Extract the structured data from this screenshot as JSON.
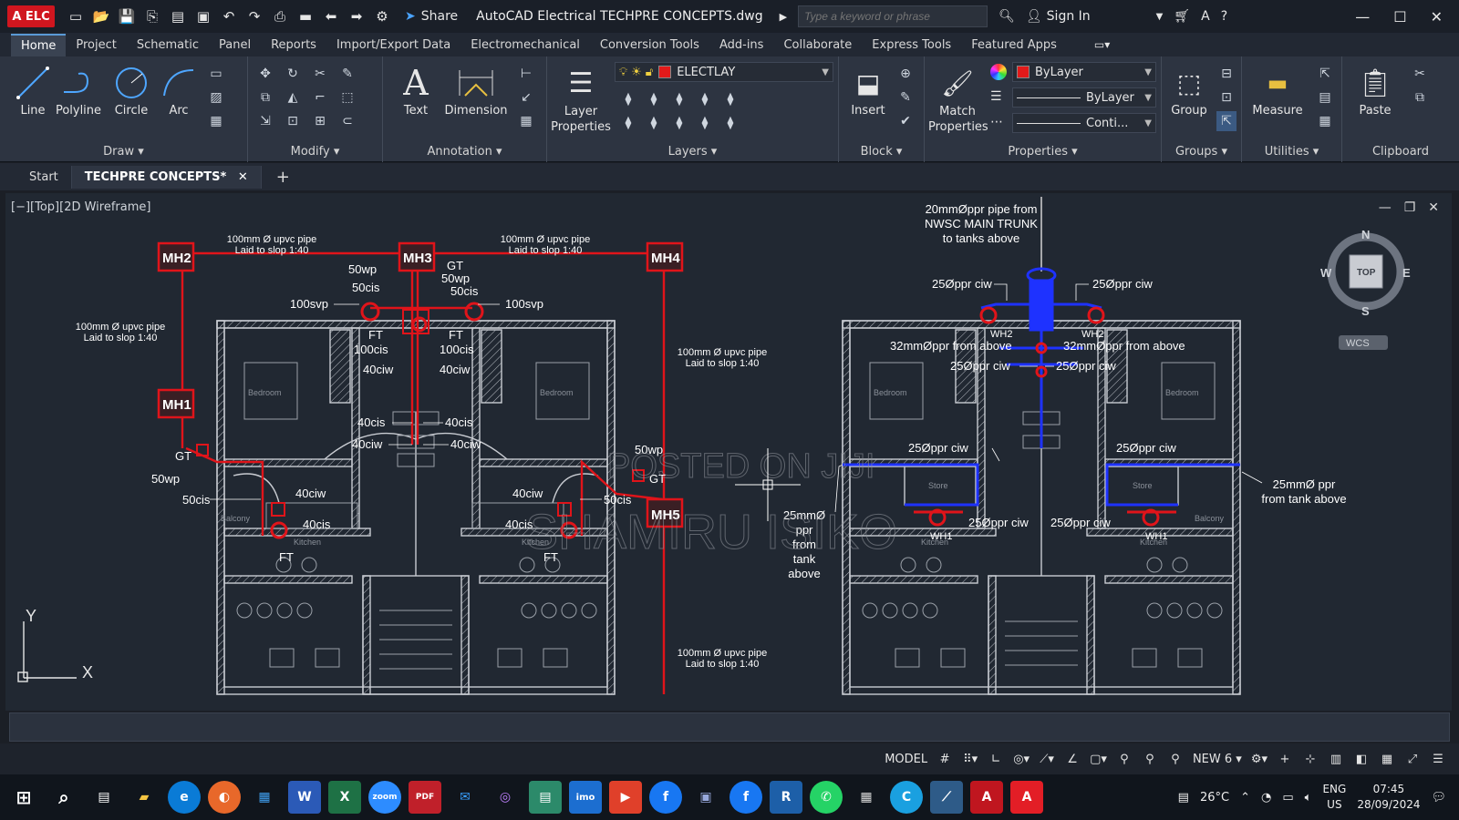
{
  "titlebar": {
    "logo": "A ELC",
    "share": "Share",
    "title": "AutoCAD Electrical   TECHPRE CONCEPTS.dwg",
    "search_placeholder": "Type a keyword or phrase",
    "sign_in": "Sign In"
  },
  "ribbon_tabs": [
    "Home",
    "Project",
    "Schematic",
    "Panel",
    "Reports",
    "Import/Export Data",
    "Electromechanical",
    "Conversion Tools",
    "Add-ins",
    "Collaborate",
    "Express Tools",
    "Featured Apps"
  ],
  "ribbon": {
    "draw": {
      "line": "Line",
      "polyline": "Polyline",
      "circle": "Circle",
      "arc": "Arc",
      "title": "Draw"
    },
    "modify_title": "Modify",
    "annotation": {
      "text": "Text",
      "dimension": "Dimension",
      "title": "Annotation"
    },
    "layers": {
      "layer_properties": "Layer Properties",
      "current_layer": "ELECTLAY",
      "title": "Layers"
    },
    "block": {
      "insert": "Insert",
      "title": "Block"
    },
    "properties": {
      "match": "Match Properties",
      "color": "ByLayer",
      "lineweight": "ByLayer",
      "linetype": "Conti...",
      "title": "Properties"
    },
    "groups": {
      "group": "Group",
      "title": "Groups"
    },
    "utilities": {
      "measure": "Measure",
      "title": "Utilities"
    },
    "clipboard": {
      "paste": "Paste",
      "title": "Clipboard"
    }
  },
  "doc_tabs": {
    "start": "Start",
    "active": "TECHPRE CONCEPTS*"
  },
  "viewport": {
    "label": "[−][Top][2D Wireframe]"
  },
  "viewcube": {
    "n": "N",
    "s": "S",
    "e": "E",
    "w": "W",
    "top": "TOP",
    "wcs": "WCS"
  },
  "ucs": {
    "x": "X",
    "y": "Y"
  },
  "drawing": {
    "manholes": [
      "MH1",
      "MH2",
      "MH3",
      "MH4",
      "MH5"
    ],
    "pipe_label_main": "100mm Ø upvc pipe",
    "slope_label": "Laid to slop 1:40",
    "left_labels": [
      "GT",
      "50wp",
      "50cis",
      "100svp",
      "FT",
      "100cis",
      "40ciw",
      "40cis",
      "40ciw",
      "50wp",
      "50cis",
      "40ciw",
      "40cis",
      "FT"
    ],
    "right_labels": {
      "trunk": "20mmØppr pipe from",
      "trunk2": "NWSC MAIN TRUNK",
      "trunk3": "to tanks above",
      "ciw25": "25Øppr ciw",
      "wh2": "WH2",
      "wh1": "WH1",
      "ppr32": "32mmØppr from above",
      "ppr25_tank": "25mmØ ppr",
      "from_tank": "from tank above",
      "ppr25_stack": [
        "25mmØ",
        "ppr",
        "from",
        "tank",
        "above"
      ]
    },
    "rooms": {
      "bedroom": "Bedroom",
      "store": "Store",
      "balcony": "Balcony",
      "kitchen": "Kitchen"
    },
    "watermark": [
      "POSTED ON JIJI",
      "SHAMIRU ISIKO"
    ]
  },
  "status": {
    "model": "MODEL",
    "annoscale": "NEW 6"
  },
  "taskbar": {
    "temp": "26°C",
    "lang1": "ENG",
    "lang2": "US",
    "time": "07:45",
    "date": "28/09/2024"
  },
  "colors": {
    "pipe_red": "#e0141a",
    "water_blue": "#1e32ff",
    "wall": "#c9ccd2",
    "bg": "#212832"
  }
}
